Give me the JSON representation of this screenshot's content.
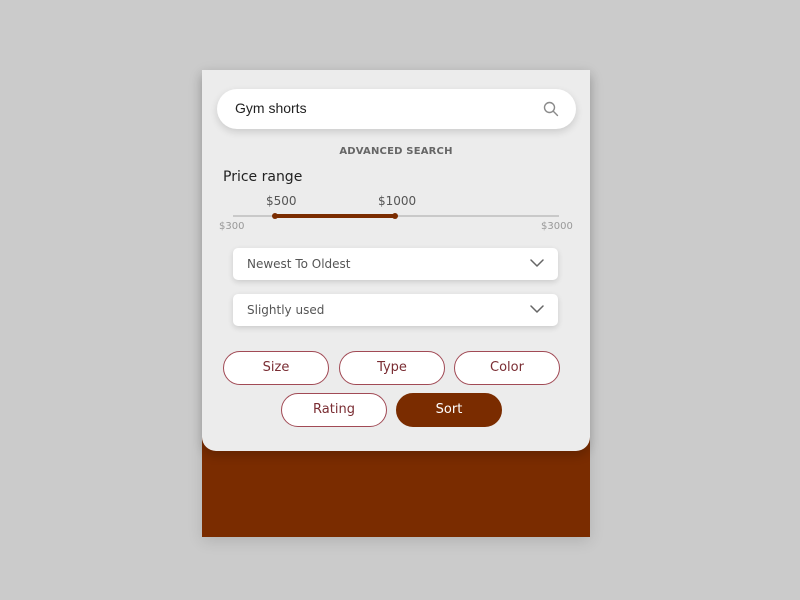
{
  "search": {
    "value": "Gym shorts",
    "icon": "search-icon"
  },
  "advanced_search_label": "ADVANCED SEARCH",
  "price_range": {
    "label": "Price range",
    "min_label": "$300",
    "max_label": "$3000",
    "low_value_label": "$500",
    "high_value_label": "$1000",
    "min": 300,
    "max": 3000,
    "low": 500,
    "high": 1000
  },
  "sort_select": {
    "value": "Newest To Oldest",
    "icon": "chevron-down-icon"
  },
  "condition_select": {
    "value": "Slightly used",
    "icon": "chevron-down-icon"
  },
  "filters": {
    "size": "Size",
    "type": "Type",
    "color": "Color",
    "rating": "Rating",
    "sort": "Sort"
  },
  "colors": {
    "accent": "#7a2c00",
    "pill_border": "#a14a55",
    "pill_text": "#7a2d33",
    "panel_bg": "#ececec",
    "page_bg": "#cbcbcb"
  }
}
